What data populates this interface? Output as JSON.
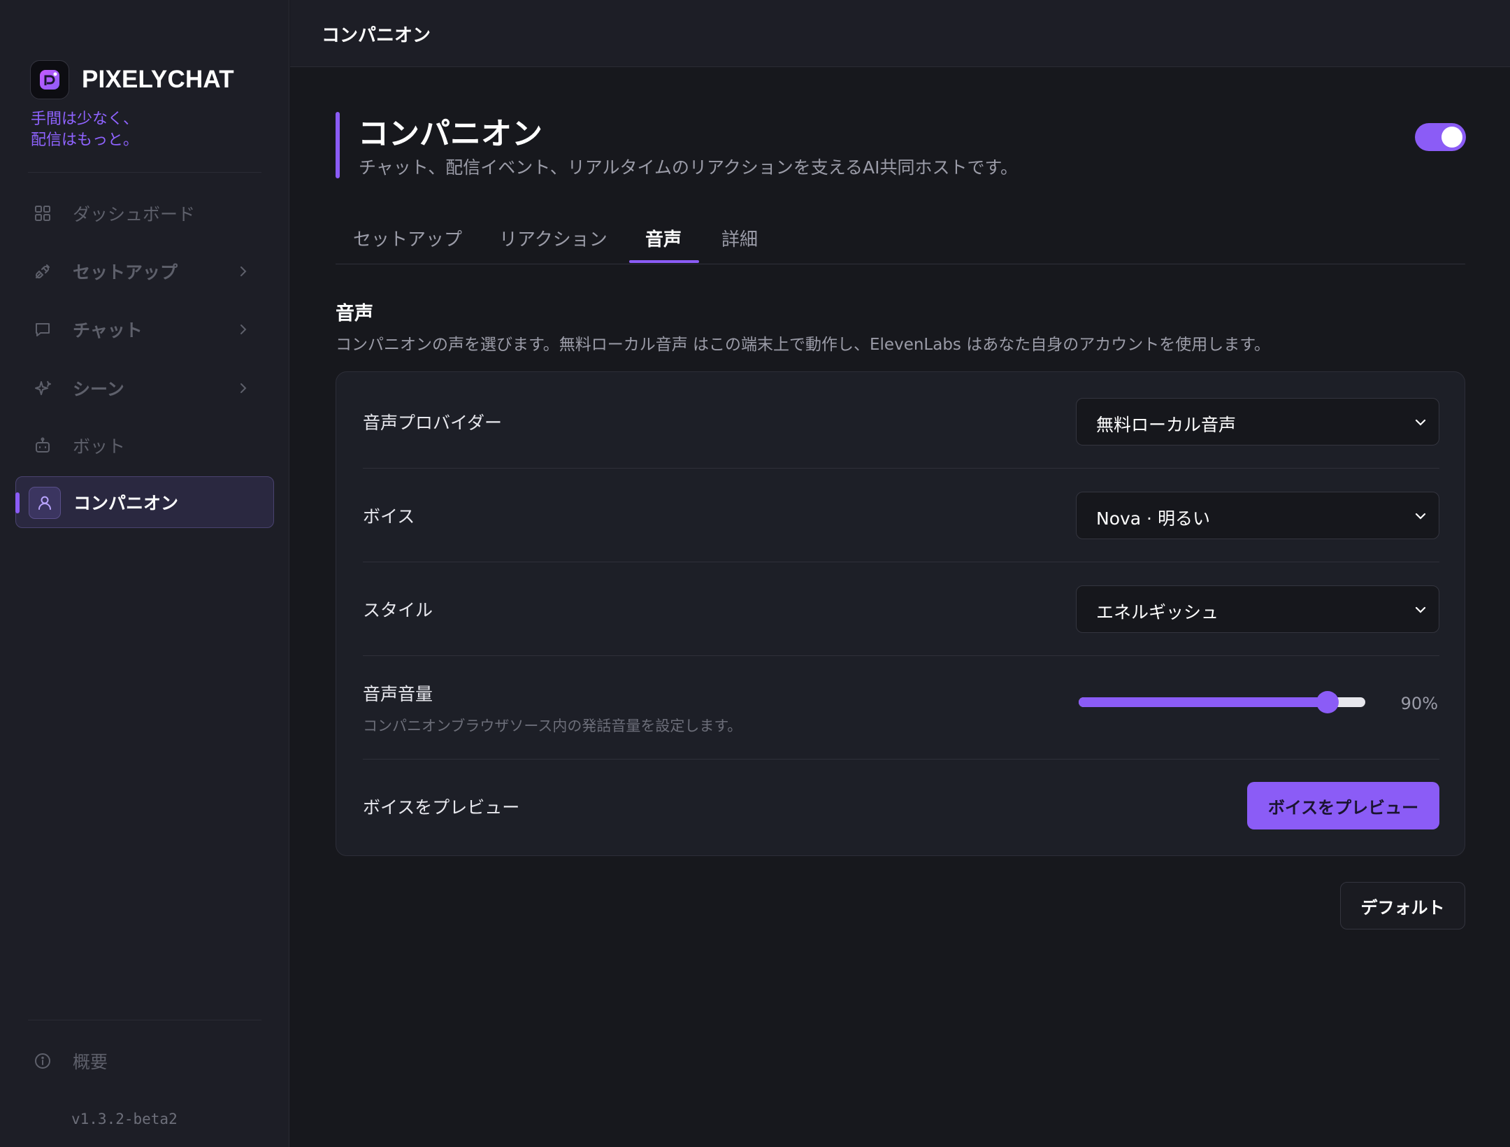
{
  "app": {
    "name": "PIXELYCHAT",
    "tagline_line1": "手間は少なく、",
    "tagline_line2": "配信はもっと。",
    "version": "v1.3.2-beta2",
    "accent_color": "#8b5cf6"
  },
  "sidebar": {
    "items": [
      {
        "label": "ダッシュボード",
        "icon": "dashboard-grid-icon"
      },
      {
        "label": "セットアップ",
        "icon": "plug-icon",
        "has_submenu": true
      },
      {
        "label": "チャット",
        "icon": "chat-bubble-icon",
        "has_submenu": true
      },
      {
        "label": "シーン",
        "icon": "sparkle-icon",
        "has_submenu": true
      },
      {
        "label": "ボット",
        "icon": "robot-icon"
      },
      {
        "label": "コンパニオン",
        "icon": "user-icon",
        "active": true
      }
    ],
    "footer": {
      "label": "概要",
      "icon": "info-circle-icon"
    }
  },
  "topbar": {
    "title": "コンパニオン"
  },
  "page": {
    "title": "コンパニオン",
    "subtitle": "チャット、配信イベント、リアルタイムのリアクションを支えるAI共同ホストです。",
    "enabled": true
  },
  "tabs": [
    {
      "label": "セットアップ"
    },
    {
      "label": "リアクション"
    },
    {
      "label": "音声",
      "active": true
    },
    {
      "label": "詳細"
    }
  ],
  "section": {
    "title": "音声",
    "description": "コンパニオンの声を選びます。無料ローカル音声 はこの端末上で動作し、ElevenLabs はあなた自身のアカウントを使用します。"
  },
  "settings": {
    "provider": {
      "label": "音声プロバイダー",
      "value": "無料ローカル音声"
    },
    "voice": {
      "label": "ボイス",
      "value": "Nova · 明るい"
    },
    "style": {
      "label": "スタイル",
      "value": "エネルギッシュ"
    },
    "volume": {
      "label": "音声音量",
      "help": "コンパニオンブラウザソース内の発話音量を設定します。",
      "value_percent": 90,
      "display": "90%"
    },
    "preview": {
      "label": "ボイスをプレビュー",
      "button": "ボイスをプレビュー"
    }
  },
  "actions": {
    "default_button": "デフォルト"
  }
}
